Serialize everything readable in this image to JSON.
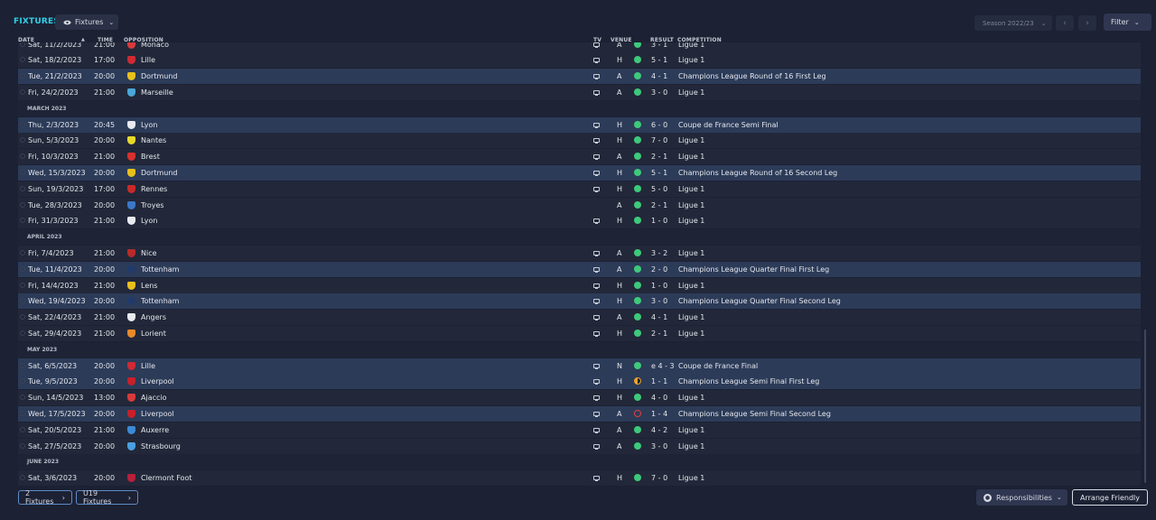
{
  "header": {
    "title": "FIXTURES",
    "view_label": "Fixtures",
    "season_label": "Season 2022/23",
    "filter_label": "Filter"
  },
  "columns": {
    "date": "DATE",
    "time": "TIME",
    "opposition": "OPPOSITION",
    "tv": "TV",
    "venue": "VENUE",
    "result": "RESULT",
    "competition": "COMPETITION"
  },
  "month_headers": [
    "MARCH 2023",
    "APRIL 2023",
    "MAY 2023",
    "JUNE 2023"
  ],
  "fixtures": [
    {
      "date": "Sat, 11/2/2023",
      "time": "21:00",
      "opp": "Monaco",
      "tv": true,
      "venue": "A",
      "result": "3 - 1",
      "comp": "Ligue 1",
      "outcome": "win",
      "crest": "#d83a3a",
      "hl": false
    },
    {
      "date": "Sat, 18/2/2023",
      "time": "17:00",
      "opp": "Lille",
      "tv": true,
      "venue": "H",
      "result": "5 - 1",
      "comp": "Ligue 1",
      "outcome": "win",
      "crest": "#cf2a35",
      "hl": false
    },
    {
      "date": "Tue, 21/2/2023",
      "time": "20:00",
      "opp": "Dortmund",
      "tv": true,
      "venue": "A",
      "result": "4 - 1",
      "comp": "Champions League Round of 16 First Leg",
      "outcome": "win",
      "crest": "#e8c01c",
      "hl": true
    },
    {
      "date": "Fri, 24/2/2023",
      "time": "21:00",
      "opp": "Marseille",
      "tv": true,
      "venue": "A",
      "result": "3 - 0",
      "comp": "Ligue 1",
      "outcome": "win",
      "crest": "#4aa7d8",
      "hl": false
    },
    {
      "month": 0
    },
    {
      "date": "Thu, 2/3/2023",
      "time": "20:45",
      "opp": "Lyon",
      "tv": true,
      "venue": "H",
      "result": "6 - 0",
      "comp": "Coupe de France Semi Final",
      "outcome": "win",
      "crest": "#e8eaf0",
      "hl": true
    },
    {
      "date": "Sun, 5/3/2023",
      "time": "20:00",
      "opp": "Nantes",
      "tv": true,
      "venue": "H",
      "result": "7 - 0",
      "comp": "Ligue 1",
      "outcome": "win",
      "crest": "#e8d82a",
      "hl": false
    },
    {
      "date": "Fri, 10/3/2023",
      "time": "21:00",
      "opp": "Brest",
      "tv": true,
      "venue": "A",
      "result": "2 - 1",
      "comp": "Ligue 1",
      "outcome": "win",
      "crest": "#d8302e",
      "hl": false
    },
    {
      "date": "Wed, 15/3/2023",
      "time": "20:00",
      "opp": "Dortmund",
      "tv": true,
      "venue": "H",
      "result": "5 - 1",
      "comp": "Champions League Round of 16 Second Leg",
      "outcome": "win",
      "crest": "#e8c01c",
      "hl": true
    },
    {
      "date": "Sun, 19/3/2023",
      "time": "17:00",
      "opp": "Rennes",
      "tv": true,
      "venue": "H",
      "result": "5 - 0",
      "comp": "Ligue 1",
      "outcome": "win",
      "crest": "#c82a2a",
      "hl": false
    },
    {
      "date": "Tue, 28/3/2023",
      "time": "20:00",
      "opp": "Troyes",
      "tv": false,
      "venue": "A",
      "result": "2 - 1",
      "comp": "Ligue 1",
      "outcome": "win",
      "crest": "#3a78c8",
      "hl": false
    },
    {
      "date": "Fri, 31/3/2023",
      "time": "21:00",
      "opp": "Lyon",
      "tv": true,
      "venue": "H",
      "result": "1 - 0",
      "comp": "Ligue 1",
      "outcome": "win",
      "crest": "#e8eaf0",
      "hl": false
    },
    {
      "month": 1
    },
    {
      "date": "Fri, 7/4/2023",
      "time": "21:00",
      "opp": "Nice",
      "tv": true,
      "venue": "A",
      "result": "3 - 2",
      "comp": "Ligue 1",
      "outcome": "win",
      "crest": "#b82a2a",
      "hl": false
    },
    {
      "date": "Tue, 11/4/2023",
      "time": "20:00",
      "opp": "Tottenham",
      "tv": true,
      "venue": "A",
      "result": "2 - 0",
      "comp": "Champions League Quarter Final First Leg",
      "outcome": "win",
      "crest": "#223a6a",
      "hl": true
    },
    {
      "date": "Fri, 14/4/2023",
      "time": "21:00",
      "opp": "Lens",
      "tv": true,
      "venue": "H",
      "result": "1 - 0",
      "comp": "Ligue 1",
      "outcome": "win",
      "crest": "#e8c01c",
      "hl": false
    },
    {
      "date": "Wed, 19/4/2023",
      "time": "20:00",
      "opp": "Tottenham",
      "tv": true,
      "venue": "H",
      "result": "3 - 0",
      "comp": "Champions League Quarter Final Second Leg",
      "outcome": "win",
      "crest": "#223a6a",
      "hl": true
    },
    {
      "date": "Sat, 22/4/2023",
      "time": "21:00",
      "opp": "Angers",
      "tv": true,
      "venue": "A",
      "result": "4 - 1",
      "comp": "Ligue 1",
      "outcome": "win",
      "crest": "#e8eaf0",
      "hl": false
    },
    {
      "date": "Sat, 29/4/2023",
      "time": "21:00",
      "opp": "Lorient",
      "tv": true,
      "venue": "H",
      "result": "2 - 1",
      "comp": "Ligue 1",
      "outcome": "win",
      "crest": "#e88a2a",
      "hl": false
    },
    {
      "month": 2
    },
    {
      "date": "Sat, 6/5/2023",
      "time": "20:00",
      "opp": "Lille",
      "tv": true,
      "venue": "N",
      "result": "e 4 - 3",
      "comp": "Coupe de France Final",
      "outcome": "win",
      "crest": "#cf2a35",
      "hl": true
    },
    {
      "date": "Tue, 9/5/2023",
      "time": "20:00",
      "opp": "Liverpool",
      "tv": true,
      "venue": "H",
      "result": "1 - 1",
      "comp": "Champions League Semi Final First Leg",
      "outcome": "draw",
      "crest": "#c8202a",
      "hl": true
    },
    {
      "date": "Sun, 14/5/2023",
      "time": "13:00",
      "opp": "Ajaccio",
      "tv": true,
      "venue": "H",
      "result": "4 - 0",
      "comp": "Ligue 1",
      "outcome": "win",
      "crest": "#d83a3a",
      "hl": false
    },
    {
      "date": "Wed, 17/5/2023",
      "time": "20:00",
      "opp": "Liverpool",
      "tv": true,
      "venue": "A",
      "result": "1 - 4",
      "comp": "Champions League Semi Final Second Leg",
      "outcome": "loss",
      "crest": "#c8202a",
      "hl": true
    },
    {
      "date": "Sat, 20/5/2023",
      "time": "21:00",
      "opp": "Auxerre",
      "tv": true,
      "venue": "A",
      "result": "4 - 2",
      "comp": "Ligue 1",
      "outcome": "win",
      "crest": "#3a8ad8",
      "hl": false
    },
    {
      "date": "Sat, 27/5/2023",
      "time": "20:00",
      "opp": "Strasbourg",
      "tv": true,
      "venue": "A",
      "result": "3 - 0",
      "comp": "Ligue 1",
      "outcome": "win",
      "crest": "#4aa0e0",
      "hl": false
    },
    {
      "month": 3
    },
    {
      "date": "Sat, 3/6/2023",
      "time": "20:00",
      "opp": "Clermont Foot",
      "tv": true,
      "venue": "H",
      "result": "7 - 0",
      "comp": "Ligue 1",
      "outcome": "win",
      "crest": "#b8203a",
      "hl": false
    }
  ],
  "footer": {
    "fixtures_2": "2 Fixtures",
    "u19_fixtures": "U19 Fixtures",
    "responsibilities": "Responsibilities",
    "arrange_friendly": "Arrange Friendly"
  },
  "colors": {
    "accent": "#2fd0e8",
    "win": "#3ec97a",
    "draw": "#e8a42a",
    "loss": "#e04040",
    "row_highlight": "#2c3b58",
    "row": "#222839"
  }
}
